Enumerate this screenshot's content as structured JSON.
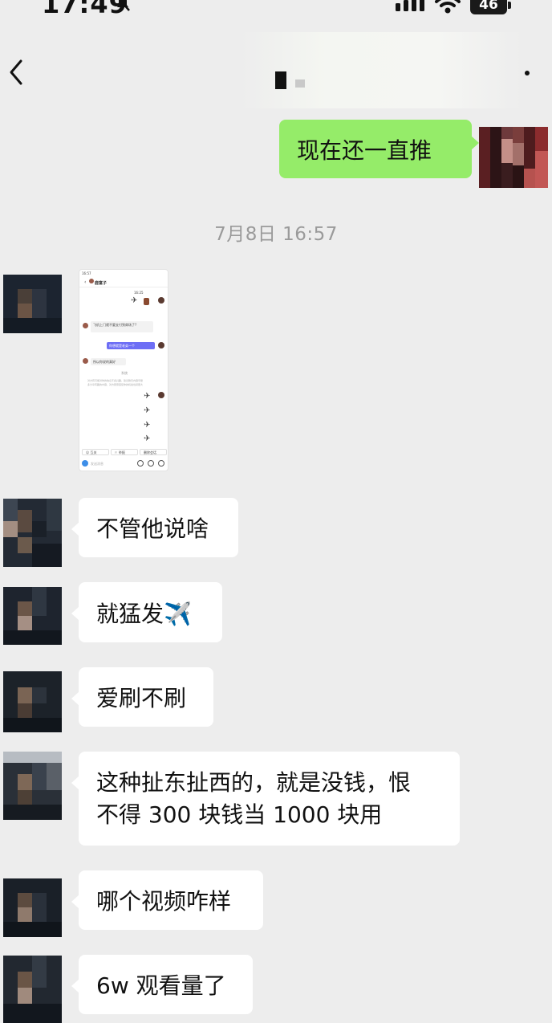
{
  "status_bar": {
    "time": "17:49",
    "network": "46"
  },
  "chat": {
    "timestamp": "7月8日 16:57",
    "messages": [
      {
        "sender": "me",
        "text": "现在还一直推"
      },
      {
        "sender": "other",
        "type": "image"
      },
      {
        "sender": "other",
        "text": "不管他说啥"
      },
      {
        "sender": "other",
        "text": "就猛发✈️"
      },
      {
        "sender": "other",
        "text": "爱刷不刷"
      },
      {
        "sender": "other",
        "text_line1": "这种扯东扯西的，就是没钱，恨",
        "text_line2": "不得 300 块钱当 1000 块用"
      },
      {
        "sender": "other",
        "text": "哪个视频咋样"
      },
      {
        "sender": "other",
        "text": "6w 观看量了"
      }
    ]
  },
  "thumbnail": {
    "title": "鹿富子",
    "time_small": "16:57",
    "date_small": "16:25",
    "msg1": "飞机上门就不要支付到商场了?",
    "msg2": "你想就是老弟一个",
    "msg3": "所以你说的真好",
    "sys_label": "系统",
    "sys_note1": "对方有可能对你的信息不感兴趣，建议聊天内容尽量",
    "sys_note2": "多分享有趣的内容，对方愿意回复你的机会也就更大",
    "btn1": "☺ 互关",
    "btn2": "⚐ 举报",
    "btn3": "删除会话",
    "input_placeholder": "发送消息"
  },
  "colors": {
    "background": "#ededed",
    "my_bubble": "#95ec69",
    "other_bubble": "#ffffff",
    "thumb_accent": "#6d6ef5"
  }
}
